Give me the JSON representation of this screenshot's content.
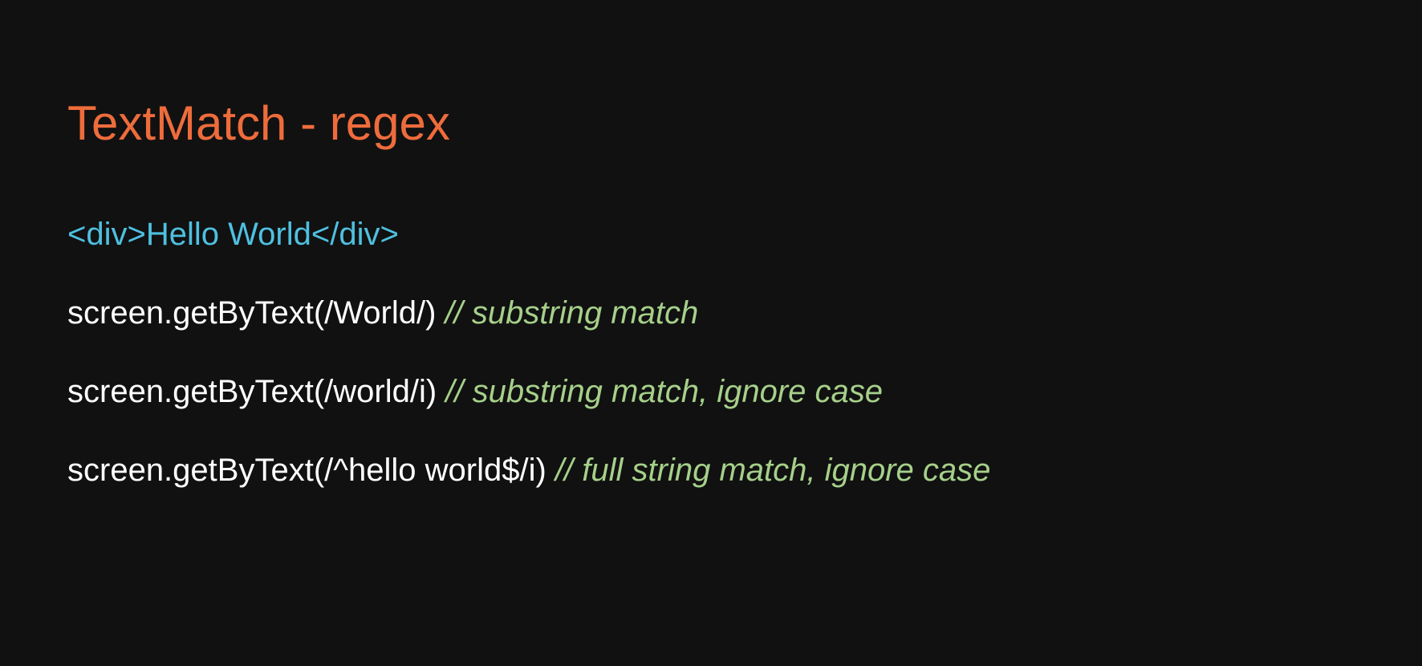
{
  "slide": {
    "title": "TextMatch - regex",
    "html_example": "<div>Hello World</div>",
    "lines": [
      {
        "code": "screen.getByText(/World/)",
        "comment": "// substring match"
      },
      {
        "code": "screen.getByText(/world/i)",
        "comment": "// substring match, ignore case"
      },
      {
        "code": "screen.getByText(/^hello world$/i)",
        "comment": "// full string match, ignore case"
      }
    ]
  },
  "colors": {
    "background": "#111111",
    "title": "#ee6c3c",
    "html_example": "#4fc0e0",
    "code": "#ffffff",
    "comment": "#a6d08a"
  }
}
